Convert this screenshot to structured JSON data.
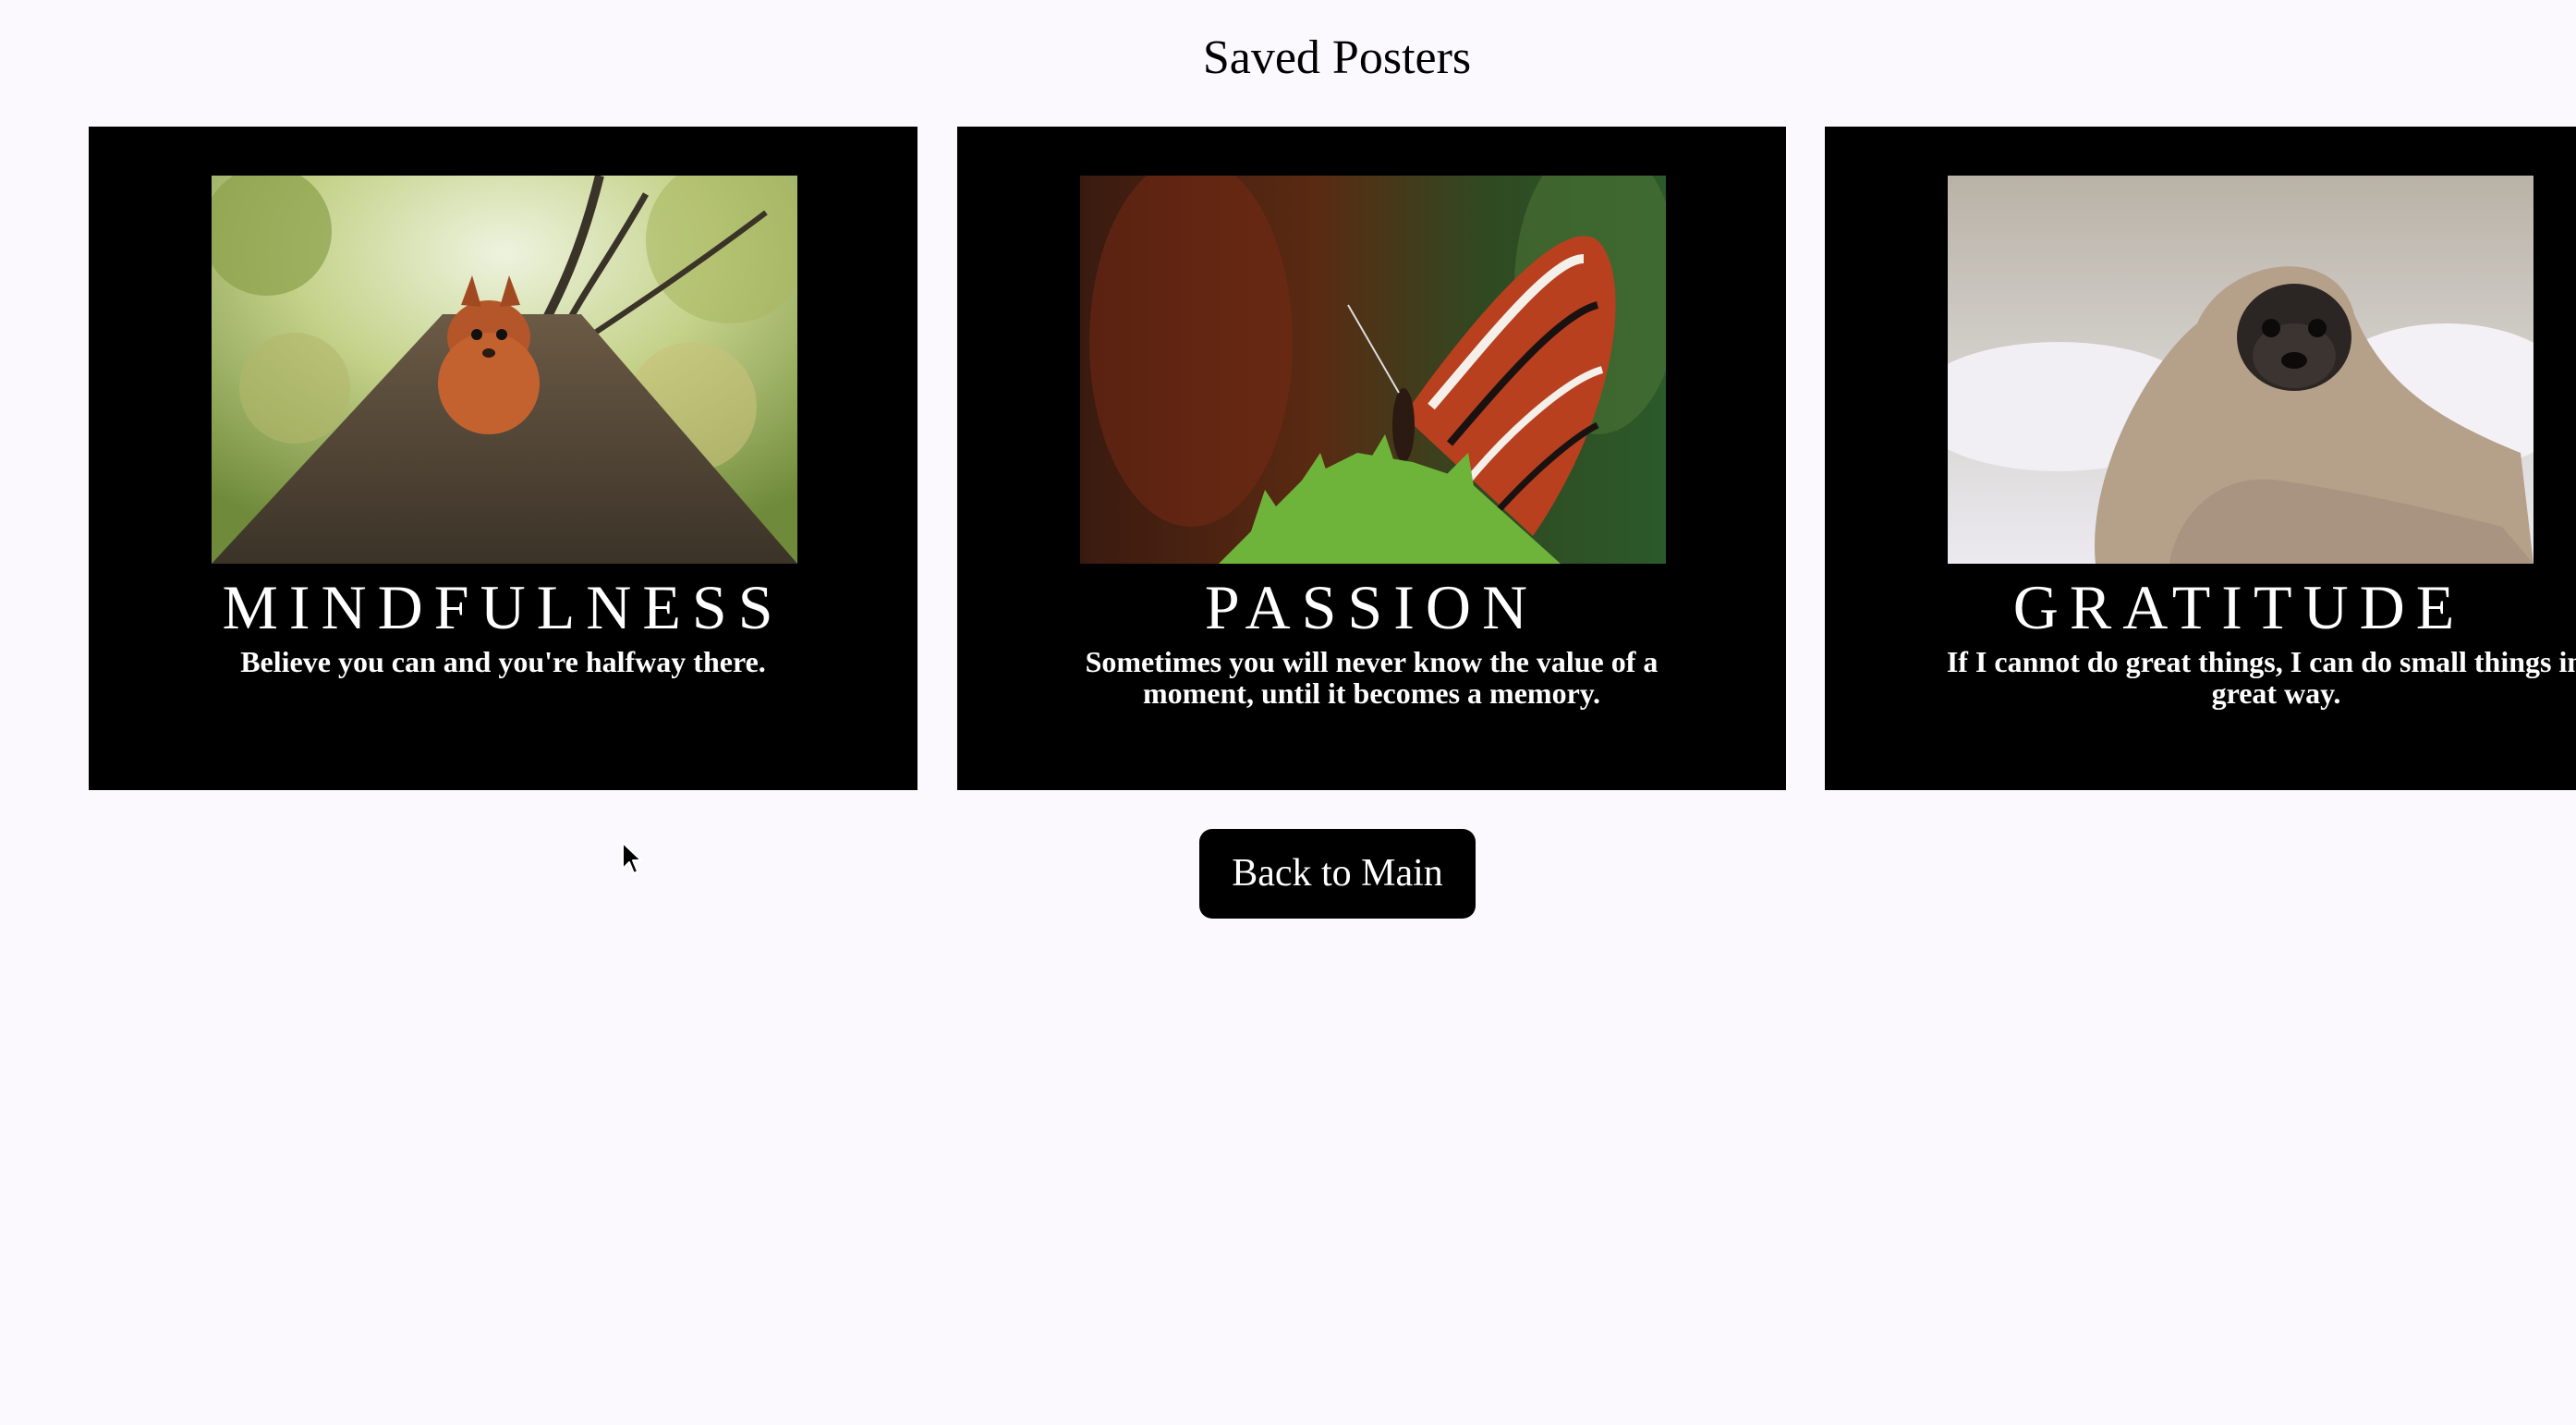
{
  "page": {
    "title": "Saved Posters"
  },
  "posters": [
    {
      "image": "squirrel-on-tree-photo",
      "title": "MINDFULNESS",
      "quote": "Believe you can and you're halfway there."
    },
    {
      "image": "butterfly-on-fern-photo",
      "title": "PASSION",
      "quote": "Sometimes you will never know the value of a moment, until it becomes a memory."
    },
    {
      "image": "pug-in-blanket-photo",
      "title": "GRATITUDE",
      "quote": "If I cannot do great things, I can do small things in a great way."
    }
  ],
  "actions": {
    "back_label": "Back to Main"
  },
  "icons": {
    "cursor": "mouse-pointer-icon"
  },
  "colors": {
    "background": "#fbf9fd",
    "poster_background": "#000000",
    "poster_text": "#ffffff",
    "button_background": "#000000",
    "button_text": "#ffffff"
  }
}
